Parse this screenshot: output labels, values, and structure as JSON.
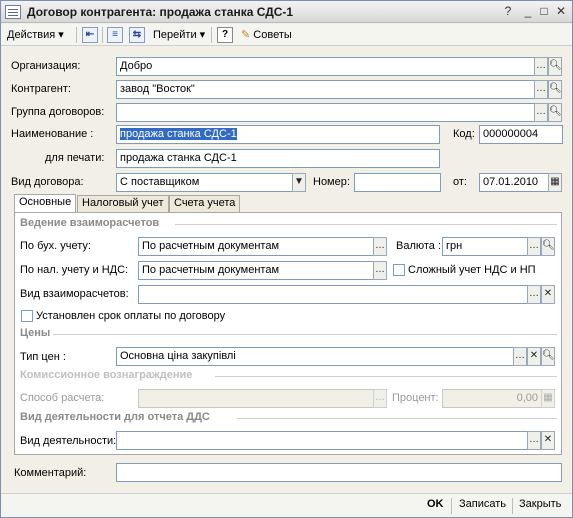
{
  "window": {
    "title": "Договор контрагента: продажа станка СДС-1"
  },
  "toolbar": {
    "actions": "Действия",
    "goto": "Перейти",
    "help": "?",
    "tips": "Советы"
  },
  "form": {
    "org_label": "Организация:",
    "org_value": "Добро",
    "contractor_label": "Контрагент:",
    "contractor_value": "завод \"Восток\"",
    "group_label": "Группа договоров:",
    "group_value": "",
    "name_label": "Наименование :",
    "name_value": "продажа станка СДС-1",
    "code_label": "Код:",
    "code_value": "000000004",
    "print_label": "для печати:",
    "print_value": "продажа станка СДС-1",
    "type_label": "Вид договора:",
    "type_value": "С поставщиком",
    "number_label": "Номер:",
    "number_value": "",
    "date_label": "от:",
    "date_value": "07.01.2010"
  },
  "tabs": [
    "Основные",
    "Налоговый учет",
    "Счета учета"
  ],
  "main": {
    "section_settlements": "Ведение взаиморасчетов",
    "acc_label": "По бух. учету:",
    "acc_value": "По расчетным документам",
    "currency_label": "Валюта :",
    "currency_value": "грн",
    "tax_label": "По нал. учету и НДС:",
    "tax_value": "По расчетным документам",
    "complex_vat_label": "Сложный  учет НДС и НП",
    "settlement_kind_label": "Вид взаиморасчетов:",
    "settlement_kind_value": "",
    "payment_term_label": "Установлен срок оплаты по договору",
    "section_prices": "Цены",
    "price_type_label": "Тип цен :",
    "price_type_value": "Основна ціна закупівлі",
    "section_commission": "Комиссионное вознаграждение",
    "calc_method_label": "Способ расчета:",
    "calc_method_value": "",
    "percent_label": "Процент:",
    "percent_value": "0,00",
    "section_activity": "Вид деятельности для отчета ДДС",
    "activity_label": "Вид деятельности:",
    "activity_value": ""
  },
  "comment": {
    "label": "Комментарий:",
    "value": ""
  },
  "bottom": {
    "ok": "OK",
    "save": "Записать",
    "close": "Закрыть"
  }
}
